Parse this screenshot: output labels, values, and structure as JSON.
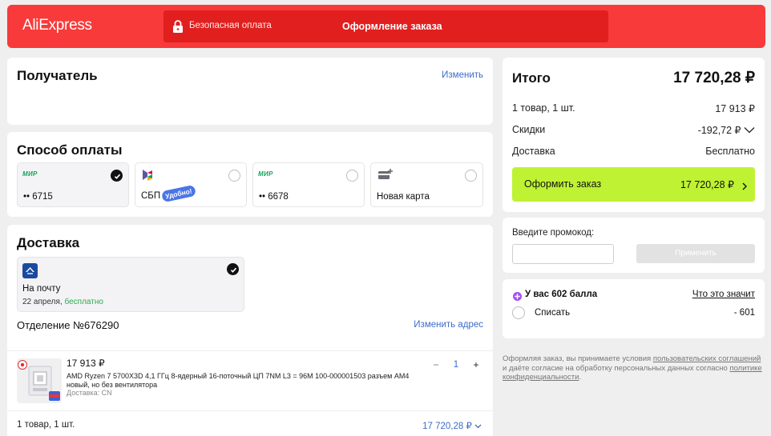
{
  "header": {
    "logo": "AliExpress",
    "secure_text": "Безопасная оплата",
    "title": "Оформление заказа"
  },
  "recipient": {
    "title": "Получатель",
    "edit_label": "Изменить"
  },
  "payment": {
    "title": "Способ оплаты",
    "options": [
      {
        "brand": "МИР",
        "label": "•• 6715",
        "selected": true
      },
      {
        "brand": "SBP",
        "label": "СБП",
        "badge": "Удобно!",
        "selected": false
      },
      {
        "brand": "МИР",
        "label": "•• 6678",
        "selected": false
      },
      {
        "brand": "new-card-icon",
        "label": "Новая карта",
        "selected": false
      }
    ]
  },
  "delivery": {
    "title": "Доставка",
    "option": {
      "name": "На почту",
      "date": "22 апреля,",
      "price_note": "бесплатно",
      "selected": true
    },
    "office": "Отделение №676290",
    "change_address": "Изменить адрес"
  },
  "product": {
    "price": "17 913 ₽",
    "name": "AMD Ryzen 7 5700X3D 4,1 ГГц 8-ядерный 16-поточный ЦП 7NM L3 = 96M 100-000001503 разъем AM4 новый, но без вентилятора",
    "shipping": "Доставка: CN",
    "qty": "1",
    "minus": "−",
    "plus": "+"
  },
  "footer_summary": {
    "count": "1 товар, 1 шт.",
    "total": "17 720,28 ₽"
  },
  "summary": {
    "title": "Итого",
    "total": "17 720,28 ₽",
    "rows": [
      {
        "label": "1 товар, 1 шт.",
        "value": "17 913 ₽"
      },
      {
        "label": "Скидки",
        "value": "-192,72 ₽"
      },
      {
        "label": "Доставка",
        "value": "Бесплатно"
      }
    ],
    "order_button": "Оформить заказ",
    "order_button_total": "17 720,28 ₽"
  },
  "promo": {
    "label": "Введите промокод:",
    "input_value": "",
    "apply_label": "Применить"
  },
  "points": {
    "text": "У вас 602 балла",
    "what_link": "Что это значит",
    "spend_label": "Списать",
    "spend_value": "- 601"
  },
  "legal": {
    "text1": "Оформляя заказ, вы принимаете условия ",
    "link1": "пользовательских соглашений",
    "text2": " и даёте согласие на обработку персональных данных согласно ",
    "link2": "политике конфиденциальности",
    "text3": "."
  },
  "colors": {
    "brand_red": "#f83a3a",
    "accent_green": "#bff233",
    "link_blue": "#3d6cc9",
    "free_green": "#2fa84f"
  }
}
